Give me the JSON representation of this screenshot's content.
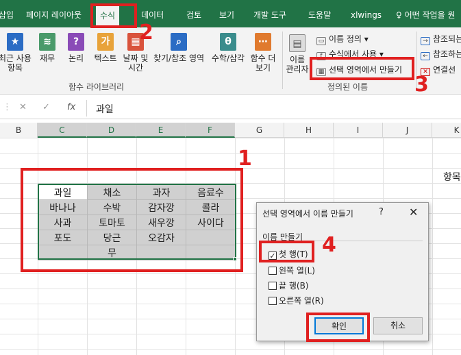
{
  "ribbon_tabs": [
    {
      "label": "삽입"
    },
    {
      "label": "페이지 레이아웃"
    },
    {
      "label": "수식"
    },
    {
      "label": "데이터"
    },
    {
      "label": "검토"
    },
    {
      "label": "보기"
    },
    {
      "label": "개발 도구"
    },
    {
      "label": "도움말"
    },
    {
      "label": "xlwings"
    },
    {
      "label": "어떤 작업을 원"
    }
  ],
  "ribbon": {
    "buttons": [
      {
        "label": "최근 사용\n항목",
        "icon": "star-icon"
      },
      {
        "label": "재무",
        "icon": "coins-icon"
      },
      {
        "label": "논리",
        "icon": "question-book-icon"
      },
      {
        "label": "텍스트",
        "icon": "text-book-icon"
      },
      {
        "label": "날짜 및\n시간",
        "icon": "calendar-icon"
      },
      {
        "label": "찾기/참조 영역",
        "icon": "search-book-icon"
      },
      {
        "label": "수학/삼각",
        "icon": "theta-icon"
      },
      {
        "label": "함수 더\n보기",
        "icon": "more-functions-icon"
      }
    ],
    "group_function_library": "함수 라이브러리",
    "name_manager": "이름\n관리자",
    "define_name": "이름 정의",
    "use_in_formula": "수식에서 사용",
    "create_from_selection": "선택 영역에서 만들기",
    "group_defined_names": "정의된 이름",
    "trace_precedents": "참조되는",
    "trace_dependents": "참조하는",
    "remove_arrows": "연결선"
  },
  "formula_bar": {
    "cancel": "✕",
    "enter": "✓",
    "fx": "fx",
    "value": "과일"
  },
  "columns": [
    "B",
    "C",
    "D",
    "E",
    "F",
    "G",
    "H",
    "I",
    "J",
    "K"
  ],
  "cell_k_fragment": "항목",
  "table": [
    [
      "과일",
      "채소",
      "과자",
      "음료수"
    ],
    [
      "바나나",
      "수박",
      "감자깡",
      "콜라"
    ],
    [
      "사과",
      "토마토",
      "새우깡",
      "사이다"
    ],
    [
      "포도",
      "당근",
      "오감자",
      ""
    ],
    [
      "",
      "무",
      "",
      ""
    ]
  ],
  "annotations": [
    "1",
    "2",
    "3",
    "4"
  ],
  "dialog": {
    "title": "선택 영역에서 이름 만들기",
    "help": "?",
    "close": "✕",
    "group": "이름 만들기",
    "options": [
      {
        "label": "첫 행(T)",
        "checked": true
      },
      {
        "label": "왼쪽 열(L)",
        "checked": false
      },
      {
        "label": "끝 행(B)",
        "checked": false
      },
      {
        "label": "오른쪽 열(R)",
        "checked": false
      }
    ],
    "ok": "확인",
    "cancel": "취소"
  },
  "colors": {
    "excel_green": "#217346",
    "annotation_red": "#e02020",
    "selected_cell": "#d0d0d0"
  }
}
